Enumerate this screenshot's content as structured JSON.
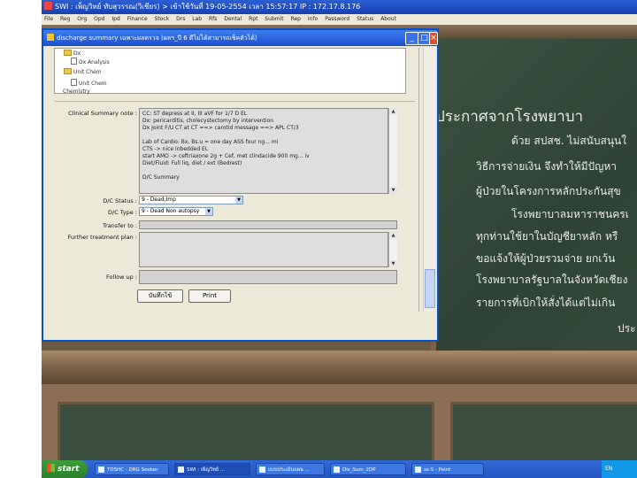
{
  "app": {
    "title": "SWI : เพ็ญวิทย์ ทับสุวรรณ(วิเชียร) > เข้าใช้วันที่ 19-05-2554 เวลา 15:57:17 IP : 172.17.8.176",
    "menu": [
      "File",
      "Reg",
      "Org",
      "Opd",
      "Ipd",
      "Finance",
      "Stock",
      "Drs",
      "Lab",
      "Rfs",
      "Dental",
      "Rpt",
      "Submit",
      "Rep",
      "Info",
      "Password",
      "Status",
      "About"
    ]
  },
  "dialog": {
    "title": "discharge summary เฉพาะผลตรวจ (ผลฯ_ปี 6 ดีไม่ได้สามารถเช็คตัวได้)",
    "tree": [
      {
        "label": "Dx",
        "icon": "folder-icon"
      },
      {
        "label": "Dx Analysis",
        "icon": "document-icon"
      },
      {
        "label": "Unit Chem",
        "icon": "folder-icon"
      },
      {
        "label": "Unit Chem",
        "icon": "document-icon"
      }
    ],
    "tree_footer": "Chemistry",
    "clinical_summary_label": "Clinical Summary note :",
    "clinical_summary_lines": [
      "CC: ST depress at II, III aVF for 1/7 D EL",
      "Dx: pericarditis, cholecystectomy by intervention",
      "Dx Joint F/U CT at CT ==> carotid message ==> APL CT/3",
      "",
      "Lab of Cardio: Bx, Bs.u = one day ASS four ng... mi",
      "CTS -> nice inbedded EL",
      "start AMO -> ceftriaxone 2g + Cef, met clindacide 900 mg... iv",
      "Diet/Fluid: Full liq, diet / ext (Bedrest)",
      "",
      "D/C Summary"
    ],
    "dc_status_label": "D/C Status :",
    "dc_status_value": "9 - Dead,Imp",
    "dc_type_label": "D/C Type :",
    "dc_type_value": "9 - Dead Non autopsy",
    "transfer_label": "Transfer to :",
    "transfer_value": "",
    "further_label": "Further treatment plan :",
    "further_value": "",
    "followup_label": "Follow up :",
    "followup_value": "",
    "save_button": "บันทึกไข้",
    "print_button": "Print"
  },
  "board": {
    "heading": "ประกาศจากโรงพยาบา",
    "lines": [
      "ด้วย สปสช. ไม่สนับสนุนใ",
      "วิธีการจ่ายเงิน จึงทำให้มีปัญหา",
      "ผู้ป่วยในโครงการหลักประกันสุข",
      "โรงพยาบาลมหาราชนครเ",
      "ทุกท่านใช้ยาในบัญชียาหลัก หรื",
      "ขอแจ้งให้ผู้ป่วยรวมจ่าย ยกเว้น",
      "โรงพยาบาลรัฐบาลในจังหวัดเชียง",
      "รายการที่เบิกให้สั่งได้แต่ไม่เกิน",
      "ประ"
    ]
  },
  "taskbar": {
    "start_label": "start",
    "tasks": [
      "TDSHC - DRG Seeker",
      "SWI : เพ็ญวิทย์ ...",
      "แบบประเมินแผน ...",
      "Dis_Sum_2DP",
      "ss-5 - Paint"
    ],
    "active_task_index": 1,
    "tray_lang": "EN",
    "clock": ""
  }
}
